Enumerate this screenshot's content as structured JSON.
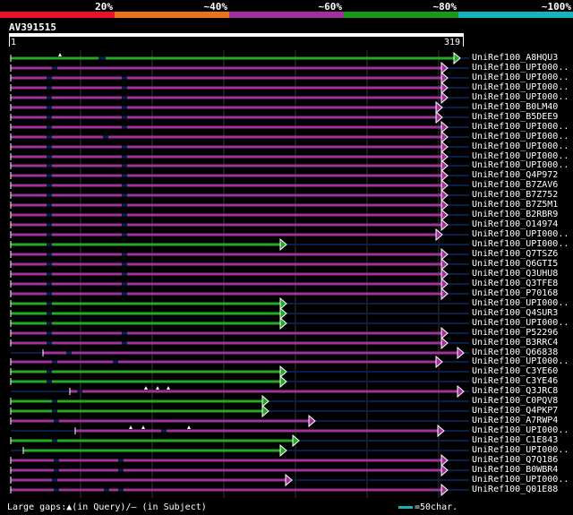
{
  "legend": [
    {
      "label": "20%",
      "color": "#e8102a"
    },
    {
      "label": "~40%",
      "color": "#e8731c"
    },
    {
      "label": "~60%",
      "color": "#a2309c"
    },
    {
      "label": "~80%",
      "color": "#159b18"
    },
    {
      "label": "~100%",
      "color": "#16b3b8"
    }
  ],
  "query": {
    "name": "AV391515",
    "start": "1",
    "end": "319"
  },
  "hits": [
    {
      "label": "UniRef100_A8HQU3",
      "color": "green",
      "end": 508,
      "gaps": [
        [
          110,
          118
        ]
      ],
      "marks": [
        [
          67,
          "q"
        ]
      ]
    },
    {
      "label": "UniRef100_UPI000..",
      "color": "purple",
      "end": 494,
      "gaps": [
        [
          58,
          64
        ]
      ],
      "marks": []
    },
    {
      "label": "UniRef100_UPI000..",
      "color": "purple",
      "end": 494,
      "gaps": [
        [
          52,
          58
        ],
        [
          136,
          142
        ]
      ],
      "marks": []
    },
    {
      "label": "UniRef100_UPI000..",
      "color": "purple",
      "end": 494,
      "gaps": [
        [
          52,
          58
        ],
        [
          136,
          142
        ]
      ],
      "marks": []
    },
    {
      "label": "UniRef100_UPI000..",
      "color": "purple",
      "end": 494,
      "gaps": [
        [
          52,
          58
        ],
        [
          136,
          142
        ]
      ],
      "marks": []
    },
    {
      "label": "UniRef100_B0LM40",
      "color": "purple",
      "end": 488,
      "gaps": [
        [
          52,
          58
        ],
        [
          136,
          142
        ]
      ],
      "marks": []
    },
    {
      "label": "UniRef100_B5DEE9",
      "color": "purple",
      "end": 488,
      "gaps": [
        [
          52,
          58
        ],
        [
          136,
          142
        ]
      ],
      "marks": []
    },
    {
      "label": "UniRef100_UPI000..",
      "color": "purple",
      "end": 494,
      "gaps": [
        [
          52,
          58
        ],
        [
          136,
          142
        ]
      ],
      "marks": []
    },
    {
      "label": "UniRef100_UPI000..",
      "color": "purple",
      "end": 494,
      "gaps": [
        [
          52,
          58
        ],
        [
          115,
          121
        ]
      ],
      "marks": []
    },
    {
      "label": "UniRef100_UPI000..",
      "color": "purple",
      "end": 494,
      "gaps": [
        [
          52,
          58
        ],
        [
          136,
          142
        ]
      ],
      "marks": []
    },
    {
      "label": "UniRef100_UPI000..",
      "color": "purple",
      "end": 494,
      "gaps": [
        [
          52,
          58
        ],
        [
          136,
          142
        ]
      ],
      "marks": []
    },
    {
      "label": "UniRef100_UPI000..",
      "color": "purple",
      "end": 494,
      "gaps": [
        [
          52,
          58
        ],
        [
          136,
          142
        ]
      ],
      "marks": []
    },
    {
      "label": "UniRef100_Q4P972",
      "color": "purple",
      "end": 494,
      "gaps": [
        [
          52,
          58
        ],
        [
          136,
          142
        ]
      ],
      "marks": []
    },
    {
      "label": "UniRef100_B7ZAV6",
      "color": "purple",
      "end": 494,
      "gaps": [
        [
          52,
          58
        ],
        [
          136,
          142
        ]
      ],
      "marks": []
    },
    {
      "label": "UniRef100_B7Z752",
      "color": "purple",
      "end": 494,
      "gaps": [
        [
          52,
          58
        ],
        [
          136,
          142
        ]
      ],
      "marks": []
    },
    {
      "label": "UniRef100_B7Z5M1",
      "color": "purple",
      "end": 494,
      "gaps": [
        [
          52,
          58
        ],
        [
          136,
          142
        ]
      ],
      "marks": []
    },
    {
      "label": "UniRef100_B2RBR9",
      "color": "purple",
      "end": 494,
      "gaps": [
        [
          52,
          58
        ],
        [
          136,
          142
        ]
      ],
      "marks": []
    },
    {
      "label": "UniRef100_O14974",
      "color": "purple",
      "end": 494,
      "gaps": [
        [
          52,
          58
        ],
        [
          136,
          142
        ]
      ],
      "marks": []
    },
    {
      "label": "UniRef100_UPI000..",
      "color": "purple",
      "end": 488,
      "gaps": [
        [
          52,
          58
        ],
        [
          136,
          142
        ]
      ],
      "marks": []
    },
    {
      "label": "UniRef100_UPI000..",
      "color": "green",
      "end": 314,
      "gaps": [
        [
          52,
          58
        ]
      ],
      "marks": []
    },
    {
      "label": "UniRef100_Q7TSZ6",
      "color": "purple",
      "end": 494,
      "gaps": [
        [
          52,
          58
        ],
        [
          136,
          142
        ]
      ],
      "marks": []
    },
    {
      "label": "UniRef100_Q6GTI5",
      "color": "purple",
      "end": 494,
      "gaps": [
        [
          52,
          58
        ],
        [
          136,
          142
        ]
      ],
      "marks": []
    },
    {
      "label": "UniRef100_Q3UHU8",
      "color": "purple",
      "end": 494,
      "gaps": [
        [
          52,
          58
        ],
        [
          136,
          142
        ]
      ],
      "marks": []
    },
    {
      "label": "UniRef100_Q3TFE8",
      "color": "purple",
      "end": 494,
      "gaps": [
        [
          52,
          58
        ],
        [
          136,
          142
        ]
      ],
      "marks": []
    },
    {
      "label": "UniRef100_P70168",
      "color": "purple",
      "end": 494,
      "gaps": [
        [
          52,
          58
        ],
        [
          136,
          142
        ]
      ],
      "marks": []
    },
    {
      "label": "UniRef100_UPI000..",
      "color": "green",
      "end": 314,
      "gaps": [
        [
          52,
          58
        ]
      ],
      "marks": []
    },
    {
      "label": "UniRef100_Q4SUR3",
      "color": "green",
      "end": 314,
      "gaps": [
        [
          52,
          58
        ]
      ],
      "marks": []
    },
    {
      "label": "UniRef100_UPI000..",
      "color": "green",
      "end": 314,
      "gaps": [
        [
          52,
          58
        ]
      ],
      "marks": []
    },
    {
      "label": "UniRef100_P52296",
      "color": "purple",
      "end": 494,
      "gaps": [
        [
          52,
          58
        ],
        [
          136,
          142
        ]
      ],
      "marks": []
    },
    {
      "label": "UniRef100_B3RRC4",
      "color": "purple",
      "end": 494,
      "gaps": [
        [
          52,
          58
        ],
        [
          136,
          142
        ]
      ],
      "marks": []
    },
    {
      "label": "UniRef100_Q66838",
      "color": "purple",
      "start": 48,
      "end": 512,
      "gaps": [
        [
          74,
          80
        ]
      ],
      "marks": []
    },
    {
      "label": "UniRef100_UPI000..",
      "color": "purple",
      "end": 488,
      "gaps": [
        [
          58,
          64
        ],
        [
          126,
          132
        ]
      ],
      "marks": []
    },
    {
      "label": "UniRef100_C3YE60",
      "color": "green",
      "end": 314,
      "gaps": [
        [
          52,
          58
        ]
      ],
      "marks": []
    },
    {
      "label": "UniRef100_C3YE46",
      "color": "green",
      "end": 314,
      "gaps": [
        [
          52,
          58
        ]
      ],
      "marks": []
    },
    {
      "label": "UniRef100_Q3JRC8",
      "color": "purple",
      "start": 78,
      "end": 512,
      "gaps": [
        [
          86,
          92
        ]
      ],
      "marks": [
        [
          163,
          "q"
        ],
        [
          176,
          "q"
        ],
        [
          188,
          "q"
        ]
      ]
    },
    {
      "label": "UniRef100_C0PQV8",
      "color": "green",
      "end": 294,
      "gaps": [
        [
          58,
          64
        ]
      ],
      "marks": []
    },
    {
      "label": "UniRef100_Q4PKP7",
      "color": "green",
      "end": 294,
      "gaps": [
        [
          58,
          64
        ]
      ],
      "marks": []
    },
    {
      "label": "UniRef100_A7RWP4",
      "color": "purple",
      "end": 346,
      "gaps": [
        [
          60,
          66
        ]
      ],
      "marks": []
    },
    {
      "label": "UniRef100_UPI000..",
      "color": "purple",
      "start": 84,
      "end": 490,
      "gaps": [
        [
          180,
          186
        ]
      ],
      "marks": [
        [
          146,
          "q"
        ],
        [
          160,
          "q"
        ],
        [
          211,
          "q"
        ]
      ]
    },
    {
      "label": "UniRef100_C1E843",
      "color": "green",
      "end": 328,
      "gaps": [
        [
          58,
          64
        ]
      ],
      "marks": []
    },
    {
      "label": "UniRef100_UPI000..",
      "color": "green",
      "start": 26,
      "end": 314,
      "gaps": [],
      "marks": []
    },
    {
      "label": "UniRef100_Q7Q186",
      "color": "purple",
      "end": 494,
      "gaps": [
        [
          60,
          66
        ],
        [
          132,
          138
        ]
      ],
      "marks": []
    },
    {
      "label": "UniRef100_B0WBR4",
      "color": "purple",
      "end": 494,
      "gaps": [
        [
          60,
          66
        ],
        [
          132,
          138
        ]
      ],
      "marks": []
    },
    {
      "label": "UniRef100_UPI000..",
      "color": "purple",
      "end": 320,
      "gaps": [
        [
          58,
          64
        ]
      ],
      "marks": []
    },
    {
      "label": "UniRef100_Q01E88",
      "color": "purple",
      "end": 494,
      "gaps": [
        [
          60,
          66
        ],
        [
          116,
          122
        ],
        [
          132,
          138
        ]
      ],
      "marks": []
    }
  ],
  "colors": {
    "green": "#25a823",
    "purple": "#a0329b",
    "gap": "#0a1e4a",
    "grid": "#333333"
  },
  "footer": {
    "text": "Large gaps:▲(in Query)/― (in Subject)"
  },
  "scale": {
    "text": "=50char."
  }
}
